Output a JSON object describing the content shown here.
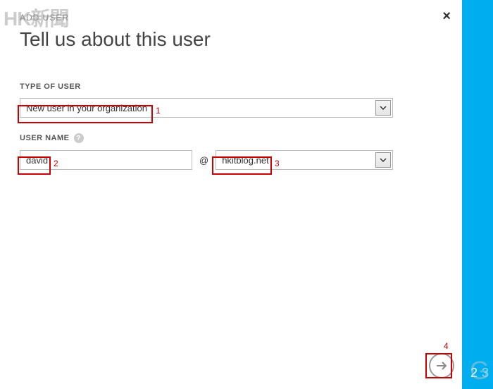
{
  "watermark_left": "HK新聞",
  "watermark_right": "G",
  "breadcrumb": "ADD USER",
  "page_title": "Tell us about this user",
  "type_of_user": {
    "label": "TYPE OF USER",
    "value": "New user in your organization"
  },
  "username": {
    "label": "USER NAME",
    "value": "david",
    "at": "@",
    "domain": "hkitblog.net"
  },
  "callouts": {
    "c1": "1",
    "c2": "2",
    "c3": "3",
    "c4": "4"
  },
  "steps": {
    "s2": "2",
    "s3": "3"
  },
  "close": "×",
  "help": "?"
}
